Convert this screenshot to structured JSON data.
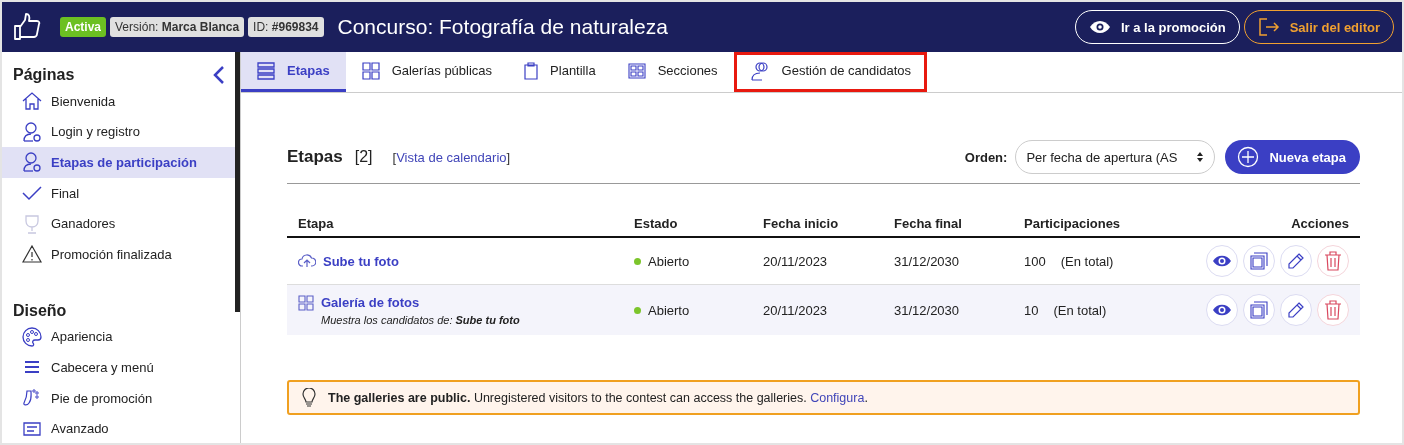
{
  "header": {
    "status_badge": "Activa",
    "version_label": "Versión:",
    "version_value": "Marca Blanca",
    "id_label": "ID:",
    "id_value": "#969834",
    "title": "Concurso: Fotografía de naturaleza",
    "buttons": [
      {
        "label": "Ir a la promoción",
        "kind": "view"
      },
      {
        "label": "Salir del editor",
        "kind": "exit"
      }
    ]
  },
  "sidebar": {
    "collapse_button": true,
    "sections": [
      {
        "title": "Páginas",
        "items": [
          {
            "label": "Bienvenida",
            "selected": false
          },
          {
            "label": "Login y registro",
            "selected": false
          },
          {
            "label": "Etapas de participación",
            "selected": true
          },
          {
            "label": "Final",
            "selected": false
          },
          {
            "label": "Ganadores",
            "selected": false
          },
          {
            "label": "Promoción finalizada",
            "selected": false
          }
        ]
      },
      {
        "title": "Diseño",
        "items": [
          {
            "label": "Apariencia",
            "selected": false
          },
          {
            "label": "Cabecera y menú",
            "selected": false
          },
          {
            "label": "Pie de promoción",
            "selected": false
          },
          {
            "label": "Avanzado",
            "selected": false
          }
        ]
      }
    ]
  },
  "tabs": [
    {
      "label": "Etapas",
      "selected": true,
      "highlighted": false
    },
    {
      "label": "Galerías públicas",
      "selected": false,
      "highlighted": false
    },
    {
      "label": "Plantilla",
      "selected": false,
      "highlighted": false
    },
    {
      "label": "Secciones",
      "selected": false,
      "highlighted": false
    },
    {
      "label": "Gestión de candidatos",
      "selected": false,
      "highlighted": true
    }
  ],
  "section": {
    "title": "Etapas",
    "count": "[2]",
    "link_open": "[",
    "link": "Vista de calendario",
    "link_close": "]",
    "order_label": "Orden:",
    "order_value": "Per fecha de apertura (AS",
    "new_button": "Nueva etapa"
  },
  "table": {
    "columns": [
      "Etapa",
      "Estado",
      "Fecha inicio",
      "Fecha final",
      "Participaciones",
      "Acciones"
    ],
    "rows": [
      {
        "kind": "upload",
        "name": "Sube tu foto",
        "subtitle": null,
        "status": "Abierto",
        "color": "#7cc52b",
        "start": "20/11/2023",
        "end": "31/12/2030",
        "count": "100",
        "count_note": "(En total)"
      },
      {
        "kind": "gallery",
        "name": "Galería de fotos",
        "subtitle": "Muestra los candidatos de: **Sube tu foto**",
        "status": "Abierto",
        "color": "#7cc52b",
        "start": "20/11/2023",
        "end": "31/12/2030",
        "count": "10",
        "count_note": "(En total)"
      }
    ]
  },
  "notice": {
    "text": "**The galleries are public.** Unregistered visitors to the contest can access the galleries.",
    "link": "Configura",
    "suffix": "."
  }
}
